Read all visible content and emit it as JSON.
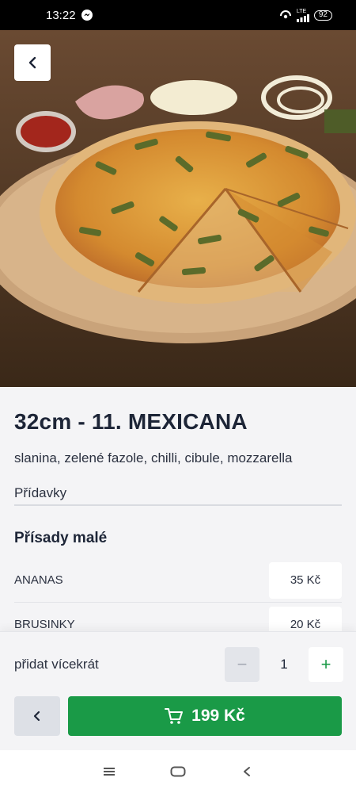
{
  "status_bar": {
    "time": "13:22",
    "network": "LTE",
    "battery": "92",
    "icons": [
      "messenger-icon",
      "hotspot-icon",
      "signal-icon",
      "battery-icon"
    ]
  },
  "hero": {
    "image": "pizza-photo",
    "back_icon": "chevron-left-icon"
  },
  "product": {
    "title": "32cm - 11. MEXICANA",
    "description": "slanina, zelené fazole, chilli, cibule, mozzarella",
    "extras_label": "Přídavky"
  },
  "ingredients": {
    "section_title": "Přísady malé",
    "items": [
      {
        "name": "ANANAS",
        "price": "35 Kč"
      },
      {
        "name": "BRUSINKY",
        "price": "20 Kč"
      }
    ]
  },
  "order": {
    "quantity_label": "přidat vícekrát",
    "minus_symbol": "−",
    "plus_symbol": "+",
    "quantity": "1",
    "total": "199 Kč",
    "cart_icon": "cart-icon",
    "back_icon": "chevron-left-icon"
  },
  "nav": {
    "icons": [
      "menu-icon",
      "home-icon",
      "back-icon"
    ]
  },
  "colors": {
    "accent": "#1a9a47",
    "text": "#1c2433",
    "background": "#f4f4f6"
  }
}
